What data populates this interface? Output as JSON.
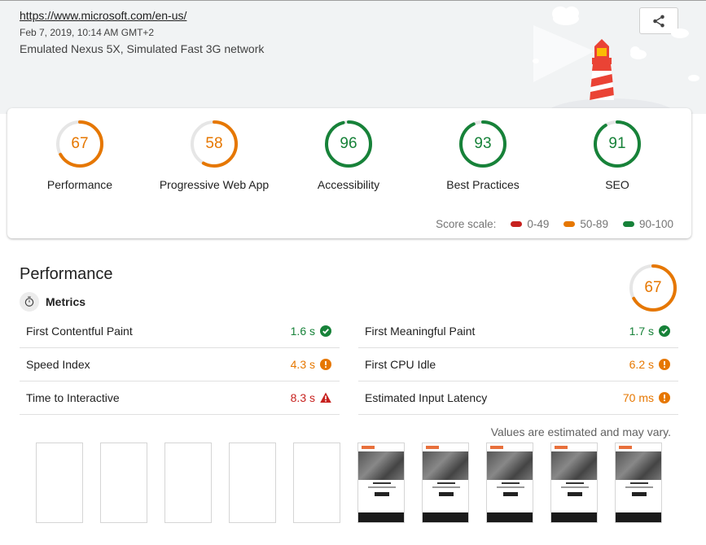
{
  "header": {
    "url": "https://www.microsoft.com/en-us/",
    "date": "Feb 7, 2019, 10:14 AM GMT+2",
    "environment": "Emulated Nexus 5X, Simulated Fast 3G network",
    "share_icon": "share-icon"
  },
  "colors": {
    "fail": "#c7221f",
    "average": "#e67700",
    "pass": "#178239"
  },
  "categories": [
    {
      "label": "Performance",
      "score": "67",
      "status": "average"
    },
    {
      "label": "Progressive Web App",
      "score": "58",
      "status": "average"
    },
    {
      "label": "Accessibility",
      "score": "96",
      "status": "pass"
    },
    {
      "label": "Best Practices",
      "score": "93",
      "status": "pass"
    },
    {
      "label": "SEO",
      "score": "91",
      "status": "pass"
    }
  ],
  "score_scale": {
    "label": "Score scale:",
    "ranges": [
      "0-49",
      "50-89",
      "90-100"
    ]
  },
  "performance": {
    "title": "Performance",
    "score": "67",
    "metrics_label": "Metrics",
    "metrics": [
      {
        "name": "First Contentful Paint",
        "value": "1.6 s",
        "status": "pass"
      },
      {
        "name": "First Meaningful Paint",
        "value": "1.7 s",
        "status": "pass"
      },
      {
        "name": "Speed Index",
        "value": "4.3 s",
        "status": "average"
      },
      {
        "name": "First CPU Idle",
        "value": "6.2 s",
        "status": "average"
      },
      {
        "name": "Time to Interactive",
        "value": "8.3 s",
        "status": "fail"
      },
      {
        "name": "Estimated Input Latency",
        "value": "70 ms",
        "status": "average"
      }
    ],
    "estimate_note": "Values are estimated and may vary."
  }
}
